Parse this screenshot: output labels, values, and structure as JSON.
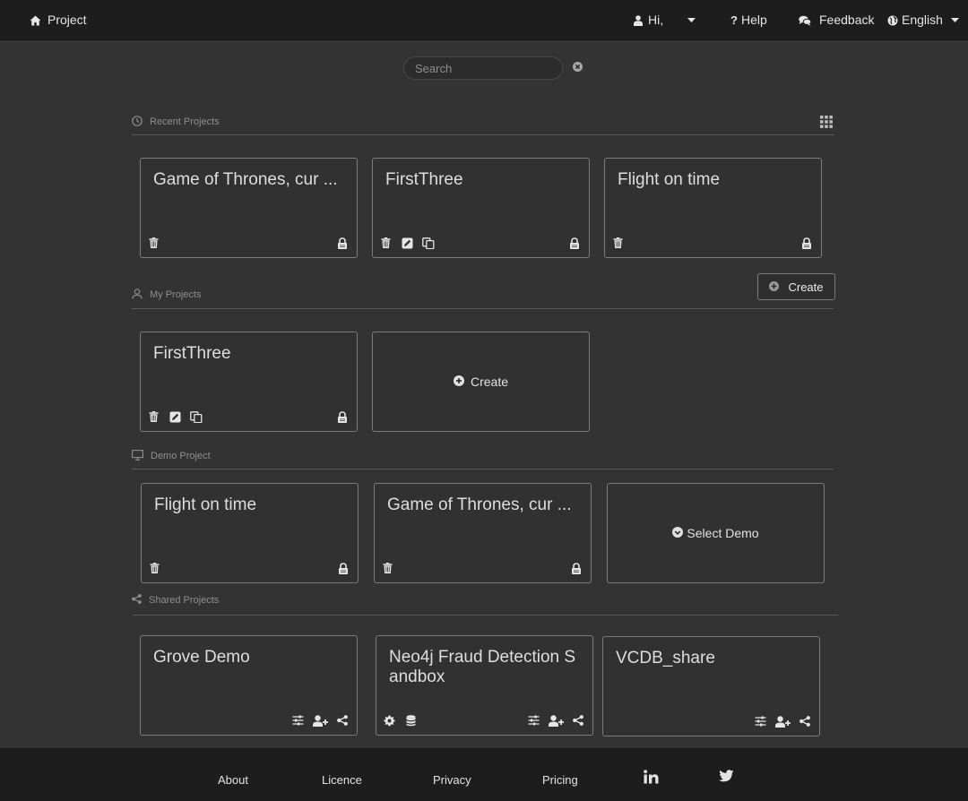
{
  "topbar": {
    "project_label": "Project",
    "user_greeting": "Hi,",
    "help_label": "Help",
    "feedback_label": "Feedback",
    "language_label": "English"
  },
  "search": {
    "placeholder": "Search",
    "value": ""
  },
  "sections": {
    "recent": "Recent Projects",
    "my": "My Projects",
    "demo": "Demo Project",
    "shared": "Shared Projects"
  },
  "recent_projects": [
    {
      "title": "Game of Thrones, cur ..."
    },
    {
      "title": "FirstThree"
    },
    {
      "title": "Flight on time"
    }
  ],
  "create_button_label": "Create",
  "my_projects": [
    {
      "title": "FirstThree"
    }
  ],
  "my_create_card_label": "Create",
  "demo_projects": [
    {
      "title": "Flight on time"
    },
    {
      "title": "Game of Thrones, cur ..."
    }
  ],
  "select_demo_label": "Select Demo",
  "shared_projects": [
    {
      "title": "Grove Demo"
    },
    {
      "title": "Neo4j Fraud Detection Sandbox"
    },
    {
      "title": "VCDB_share"
    }
  ],
  "footer": {
    "about": "About",
    "licence": "Licence",
    "privacy": "Privacy",
    "pricing": "Pricing"
  },
  "colors": {
    "background": "#333333",
    "topbar": "#1d1d1d",
    "card_border": "#7b7b7b"
  }
}
